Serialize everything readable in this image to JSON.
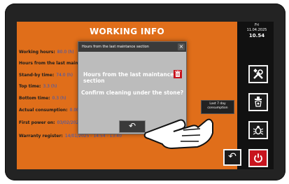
{
  "screen": {
    "title": "WORKING INFO",
    "rows": [
      {
        "label": "Working hours:",
        "value": "80.0 (h)"
      },
      {
        "label": "Hours from the last maintenance",
        "value": ""
      },
      {
        "label": "Stand-by time:",
        "value": "74.0 (h)"
      },
      {
        "label": "Top time:",
        "value": "3.3 (h)"
      },
      {
        "label": "Bottom time:",
        "value": "0.3 (h)"
      },
      {
        "label": "Actual consumption:",
        "value": "0.00"
      },
      {
        "label": "First power on:",
        "value": "03/02/2025"
      },
      {
        "label": "Warranty register:",
        "value": "14/01/2025 - 14:54 - 13:40"
      }
    ]
  },
  "dialog": {
    "header": "Hours from the last maintance section",
    "close": "×",
    "message1": "Hours from the last maintance section",
    "message2": "Confirm cleaning under the stone?",
    "back_icon": "back-arrow-icon"
  },
  "clock": {
    "day": "Fri",
    "date": "11.04.2025",
    "time": "10.54"
  },
  "tooltip": {
    "line1": "Last 7 day",
    "line2": "consumption"
  },
  "sidebar": {
    "icons": [
      "tools-icon",
      "cleaning-icon",
      "bug-icon",
      "power-icon"
    ]
  },
  "colors": {
    "screen_bg": "#e06e1a",
    "power_button": "#c8141e",
    "value_text": "#2a55c8"
  }
}
